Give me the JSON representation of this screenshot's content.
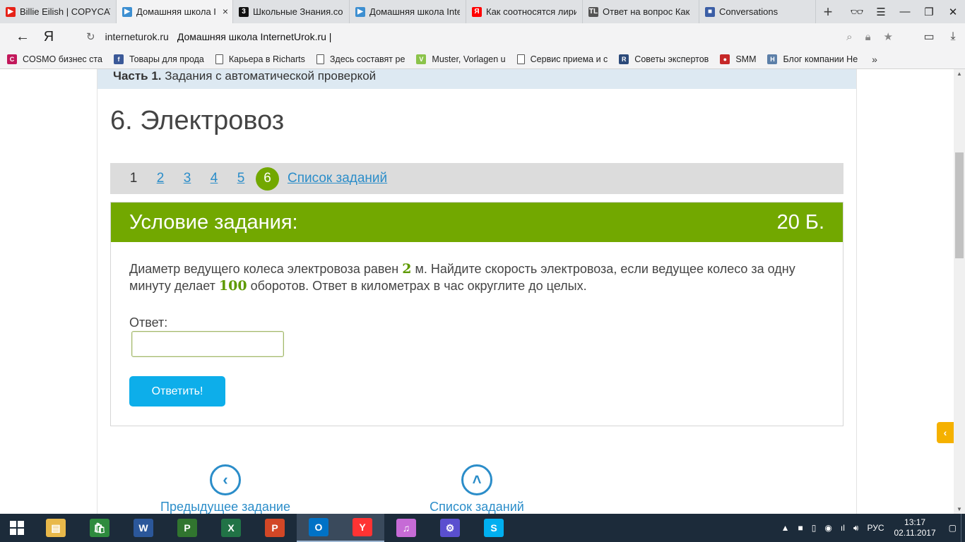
{
  "browser": {
    "tabs": [
      {
        "title": "Billie Eilish | COPYCAT",
        "favicon_color": "#e62117",
        "favicon_text": "▶",
        "active": false
      },
      {
        "title": "Домашняя школа I",
        "favicon_color": "#3d8fd1",
        "favicon_text": "▶",
        "active": true
      },
      {
        "title": "Школьные Знания.co",
        "favicon_color": "#111111",
        "favicon_text": "3",
        "active": false
      },
      {
        "title": "Домашняя школа Inte",
        "favicon_color": "#3d8fd1",
        "favicon_text": "▶",
        "active": false
      },
      {
        "title": "Как соотносятся лири",
        "favicon_color": "#ff0000",
        "favicon_text": "Я",
        "active": false
      },
      {
        "title": "Ответ на вопрос Как",
        "favicon_color": "#555555",
        "favicon_text": "TL",
        "active": false
      },
      {
        "title": "Conversations",
        "favicon_color": "#3b5ea6",
        "favicon_text": "■",
        "active": false
      }
    ],
    "new_tab_symbol": "+",
    "back_symbol": "←",
    "yandex_logo": "Я",
    "address": {
      "domain": "interneturok.ru",
      "page_title": "Домашняя школа InternetUrok.ru |"
    },
    "bookmarks": [
      {
        "label": "COSMO бизнес ста",
        "icon_color": "#c2185b",
        "icon_text": "C",
        "doc": false
      },
      {
        "label": "Товары для прода",
        "icon_color": "#3b5998",
        "icon_text": "f",
        "doc": false
      },
      {
        "label": "Карьера в Richarts",
        "icon_color": "",
        "icon_text": "",
        "doc": true
      },
      {
        "label": "Здесь составят ре",
        "icon_color": "",
        "icon_text": "",
        "doc": true
      },
      {
        "label": "Muster, Vorlagen u",
        "icon_color": "#8bc34a",
        "icon_text": "V",
        "doc": false
      },
      {
        "label": "Сервис приема и с",
        "icon_color": "",
        "icon_text": "",
        "doc": true
      },
      {
        "label": "Советы экспертов",
        "icon_color": "#2c4a7a",
        "icon_text": "R",
        "doc": false
      },
      {
        "label": "SMM",
        "icon_color": "#c62828",
        "icon_text": "●",
        "doc": false
      },
      {
        "label": "Блог компании Не",
        "icon_color": "#5c7fa8",
        "icon_text": "H",
        "doc": false
      }
    ],
    "bookmarks_more": "»"
  },
  "page": {
    "part_strip": {
      "bold": "Часть 1.",
      "text": "Задания с автоматической проверкой"
    },
    "task_title": "6. Электровоз",
    "pager": {
      "pages": [
        "1",
        "2",
        "3",
        "4",
        "5",
        "6"
      ],
      "current": "6",
      "list_link": "Список заданий"
    },
    "card": {
      "heading": "Условие задания:",
      "points": "20 Б.",
      "text_before": "Диаметр ведущего колеса электровоза равен ",
      "num1": "2",
      "text_mid": " м. Найдите скорость электровоза, если ведущее колесо за одну минуту делает ",
      "num2": "100",
      "text_after": " оборотов. Ответ в километрах в час округлите до целых.",
      "answer_label": "Ответ:",
      "answer_value": "",
      "submit_label": "Ответить!"
    },
    "nav": {
      "prev_label": "Предыдущее задание",
      "list_label": "Список заданий"
    },
    "accent_color": "#72a800",
    "link_color": "#2b8dc9",
    "button_color": "#0daeea"
  },
  "taskbar": {
    "apps": [
      {
        "name": "file-explorer",
        "color": "#e8b84a",
        "text": "▤"
      },
      {
        "name": "store",
        "color": "#2e8b3e",
        "text": "🛍"
      },
      {
        "name": "word",
        "color": "#2b579a",
        "text": "W"
      },
      {
        "name": "project",
        "color": "#31752f",
        "text": "P"
      },
      {
        "name": "excel",
        "color": "#217346",
        "text": "X"
      },
      {
        "name": "powerpoint",
        "color": "#d24726",
        "text": "P"
      },
      {
        "name": "outlook",
        "color": "#0072c6",
        "text": "O"
      },
      {
        "name": "yandex-browser",
        "color": "#ff3333",
        "text": "Y"
      },
      {
        "name": "itunes",
        "color": "#c66bd6",
        "text": "♫"
      },
      {
        "name": "settings",
        "color": "#5a4fcf",
        "text": "⚙"
      },
      {
        "name": "skype",
        "color": "#00aff0",
        "text": "S"
      }
    ],
    "language": "РУС",
    "time": "13:17",
    "date": "02.11.2017"
  }
}
